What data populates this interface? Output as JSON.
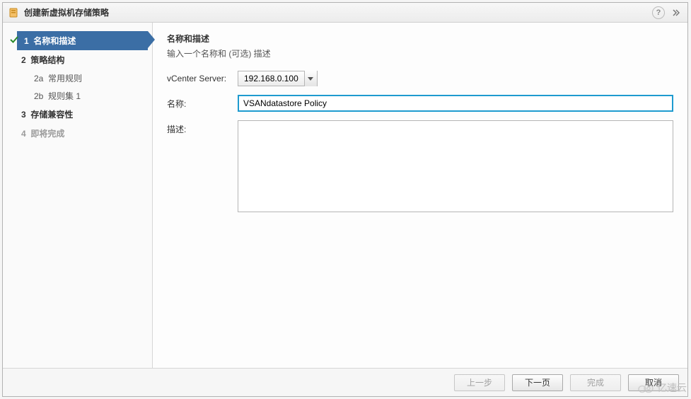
{
  "dialog": {
    "title": "创建新虚拟机存储策略"
  },
  "sidebar": {
    "steps": [
      {
        "num": "1",
        "label": "名称和描述"
      },
      {
        "num": "2",
        "label": "策略结构"
      },
      {
        "num": "2a",
        "label": "常用规则"
      },
      {
        "num": "2b",
        "label": "规则集 1"
      },
      {
        "num": "3",
        "label": "存储兼容性"
      },
      {
        "num": "4",
        "label": "即将完成"
      }
    ]
  },
  "main": {
    "title": "名称和描述",
    "subtitle": "输入一个名称和 (可选) 描述",
    "vcenter_label": "vCenter Server:",
    "vcenter_value": "192.168.0.100",
    "name_label": "名称:",
    "name_value": "VSANdatastore Policy",
    "desc_label": "描述:",
    "desc_value": ""
  },
  "footer": {
    "back": "上一步",
    "next": "下一页",
    "finish": "完成",
    "cancel": "取消"
  },
  "watermark": "亿速云"
}
